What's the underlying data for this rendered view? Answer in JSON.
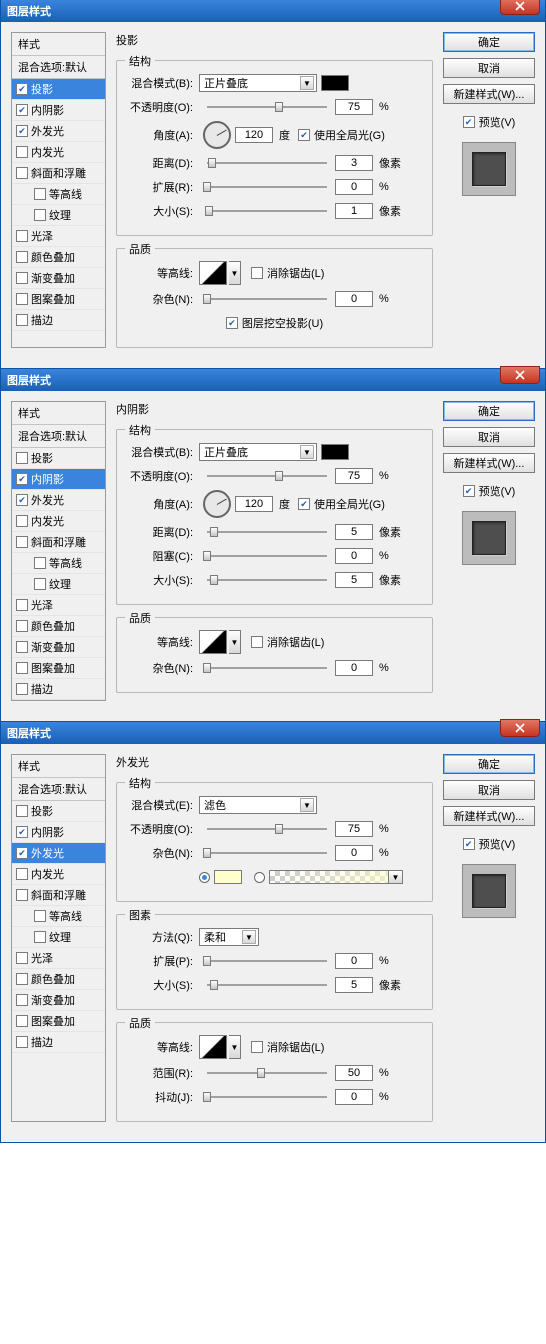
{
  "common": {
    "dialog_title": "图层样式",
    "styles_header": "样式",
    "blend_defaults": "混合选项:默认",
    "btn_ok": "确定",
    "btn_cancel": "取消",
    "btn_newstyle": "新建样式(W)...",
    "preview_chk": "预览(V)",
    "struct_legend": "结构",
    "quality_legend": "品质",
    "elements_legend": "图素",
    "blendmode_label": "混合模式(B):",
    "blendmode_label_e": "混合模式(E):",
    "opacity_label": "不透明度(O):",
    "angle_label": "角度(A):",
    "degree_label": "度",
    "global_light": "使用全局光(G)",
    "distance_label": "距离(D):",
    "spread_label": "扩展(R):",
    "spread_label_p": "扩展(P):",
    "size_label": "大小(S):",
    "choke_label": "阻塞(C):",
    "px_label": "像素",
    "pct": "%",
    "contour_label": "等高线:",
    "antialias": "消除锯齿(L)",
    "noise_label": "杂色(N):",
    "knockout": "图层挖空投影(U)",
    "method_label": "方法(Q):",
    "range_label": "范围(R):",
    "jitter_label": "抖动(J):",
    "blendmode_multiply": "正片叠底",
    "blendmode_screen": "滤色",
    "method_soft": "柔和"
  },
  "style_items": [
    {
      "key": "dropshadow",
      "label": "投影"
    },
    {
      "key": "innershadow",
      "label": "内阴影"
    },
    {
      "key": "outerglow",
      "label": "外发光"
    },
    {
      "key": "innerglow",
      "label": "内发光"
    },
    {
      "key": "bevel",
      "label": "斜面和浮雕"
    },
    {
      "key": "contour",
      "label": "等高线",
      "indent": true
    },
    {
      "key": "texture",
      "label": "纹理",
      "indent": true
    },
    {
      "key": "satin",
      "label": "光泽"
    },
    {
      "key": "coloroverlay",
      "label": "颜色叠加"
    },
    {
      "key": "gradoverlay",
      "label": "渐变叠加"
    },
    {
      "key": "patoverlay",
      "label": "图案叠加"
    },
    {
      "key": "stroke",
      "label": "描边"
    }
  ],
  "dialogs": [
    {
      "selected": "dropshadow",
      "checked": [
        "dropshadow",
        "innershadow",
        "outerglow"
      ],
      "panel_title": "投影",
      "mode": "正片叠底",
      "opacity": "75",
      "angle": "120",
      "distance": "3",
      "spread": "0",
      "size": "1",
      "noise": "0",
      "knock_checked": true
    },
    {
      "selected": "innershadow",
      "checked": [
        "innershadow",
        "outerglow"
      ],
      "panel_title": "内阴影",
      "mode": "正片叠底",
      "opacity": "75",
      "angle": "120",
      "distance": "5",
      "choke": "0",
      "size": "5",
      "noise": "0"
    },
    {
      "selected": "outerglow",
      "checked": [
        "innershadow",
        "outerglow"
      ],
      "panel_title": "外发光",
      "mode": "滤色",
      "opacity": "75",
      "noise": "0",
      "method": "柔和",
      "spread": "0",
      "size": "5",
      "range": "50",
      "jitter": "0"
    }
  ]
}
